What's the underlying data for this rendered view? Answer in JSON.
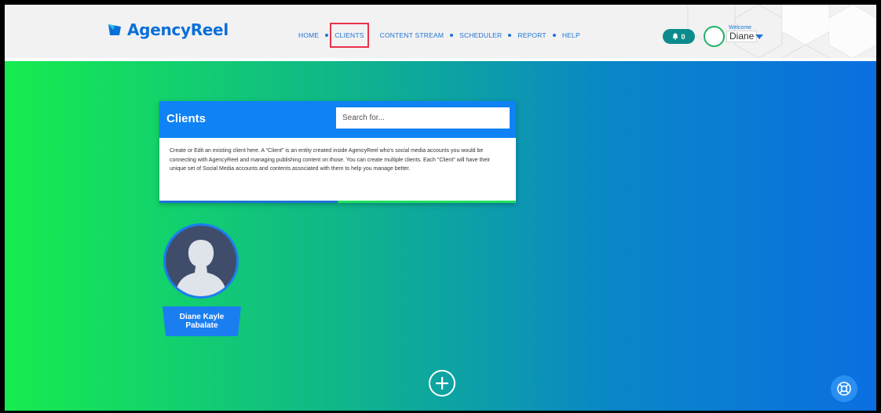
{
  "app": {
    "name": "AgencyReel"
  },
  "nav": {
    "items": [
      {
        "label": "HOME",
        "active": false
      },
      {
        "label": "CLIENTS",
        "active": true
      },
      {
        "label": "CONTENT STREAM",
        "active": false
      },
      {
        "label": "SCHEDULER",
        "active": false
      },
      {
        "label": "REPORT",
        "active": false
      },
      {
        "label": "HELP",
        "active": false
      }
    ]
  },
  "user": {
    "notifications": "0",
    "welcome": "Welcome",
    "name": "Diane"
  },
  "clients_card": {
    "title": "Clients",
    "search_placeholder": "Search for...",
    "description": "Create or Edit an existing client here. A \"Client\" is an entity created inside AgencyReel who's social media accounts you would be connecting with AgencyReel and managing publishing content on those. You can create multiple clients. Each \"Client\" will have their unique set of Social Media accounts and contents associated with them to help you manage better."
  },
  "clients": [
    {
      "name_line1": "Diane Kayle",
      "name_line2": "Pabalate"
    }
  ],
  "colors": {
    "brand_blue": "#0a6fd9",
    "accent_green": "#1ee05d",
    "active_outline": "#e8334b",
    "bell_teal": "#0c8b8c"
  }
}
